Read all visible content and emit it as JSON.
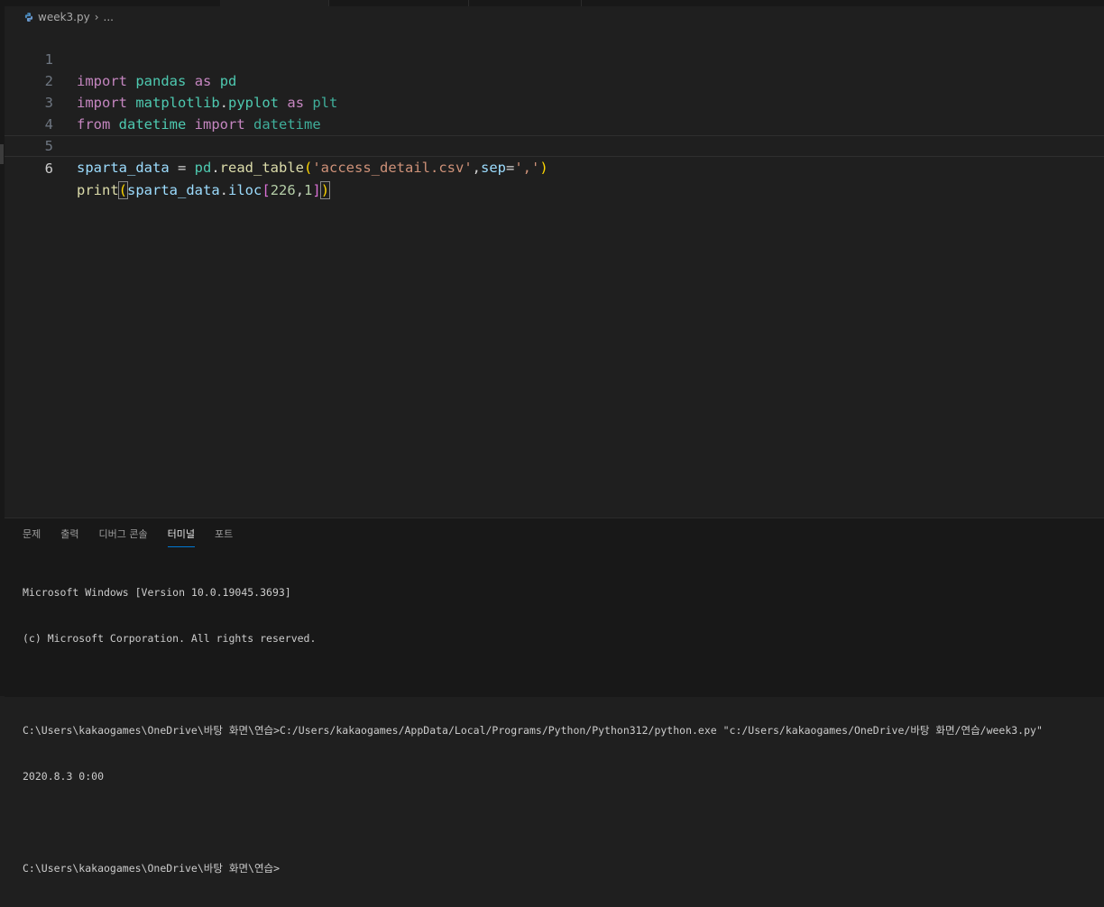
{
  "breadcrumb": {
    "file": "week3.py",
    "more": "..."
  },
  "editor": {
    "active_line": 6,
    "lines": [
      {
        "n": "1"
      },
      {
        "n": "2"
      },
      {
        "n": "3"
      },
      {
        "n": "4"
      },
      {
        "n": "5"
      },
      {
        "n": "6"
      }
    ],
    "tokens": {
      "l1": [
        "import",
        " ",
        "pandas",
        " ",
        "as",
        " ",
        "pd"
      ],
      "l2": [
        "import",
        " ",
        "matplotlib",
        ".",
        "pyplot",
        " ",
        "as",
        " ",
        "plt"
      ],
      "l3": [
        "from",
        " ",
        "datetime",
        " ",
        "import",
        " ",
        "datetime"
      ],
      "l5": [
        "sparta_data",
        " = ",
        "pd",
        ".",
        "read_table",
        "(",
        "'access_detail.csv'",
        ",",
        "sep",
        "=",
        "','",
        ")"
      ],
      "l6": [
        "print",
        "(",
        "sparta_data",
        ".",
        "iloc",
        "[",
        "226",
        ",",
        "1",
        "]",
        ")"
      ]
    }
  },
  "panel": {
    "tabs": [
      "문제",
      "출력",
      "디버그 콘솔",
      "터미널",
      "포트"
    ],
    "active_tab": "터미널",
    "terminal_lines": [
      "Microsoft Windows [Version 10.0.19045.3693]",
      "(c) Microsoft Corporation. All rights reserved.",
      "",
      "C:\\Users\\kakaogames\\OneDrive\\바탕 화면\\연습>C:/Users/kakaogames/AppData/Local/Programs/Python/Python312/python.exe \"c:/Users/kakaogames/OneDrive/바탕 화면/연습/week3.py\"",
      "2020.8.3 0:00",
      "",
      "C:\\Users\\kakaogames\\OneDrive\\바탕 화면\\연습>"
    ]
  },
  "colors": {
    "editor_bg": "#1f1f1f",
    "keyword": "#c586c0",
    "module": "#4ec9b0",
    "variable": "#9cdcfe",
    "function": "#dcdcaa",
    "string": "#ce9178",
    "number": "#b5cea8",
    "accent": "#0078d4"
  },
  "icons": {
    "file_icon": "python-icon",
    "separator": "chevron-right-icon"
  }
}
